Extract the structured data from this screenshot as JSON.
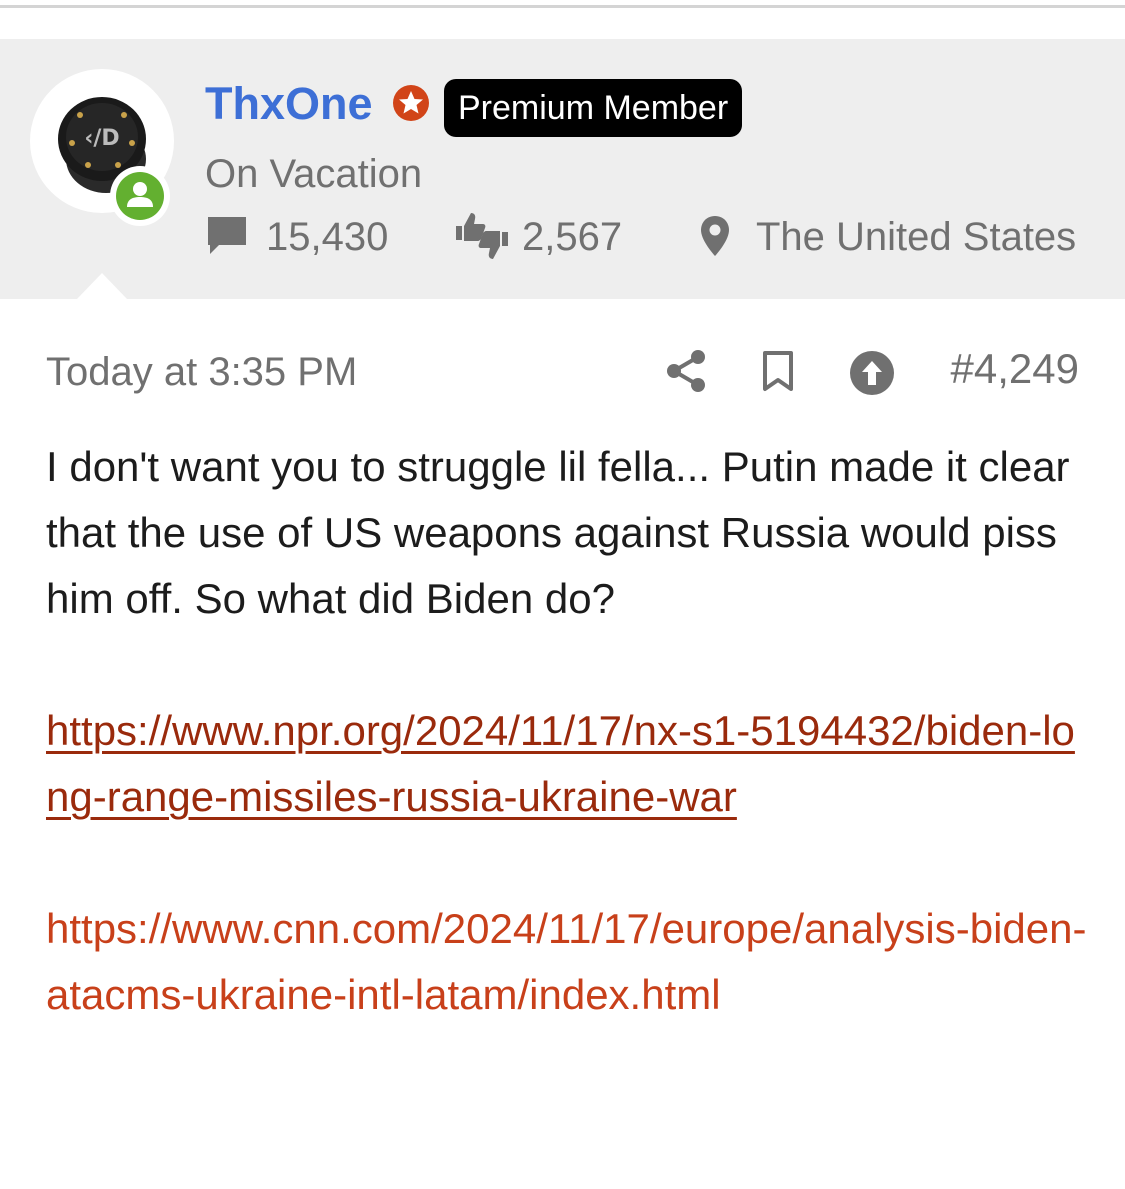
{
  "user": {
    "name": "ThxOne",
    "badge": "Premium Member",
    "status": "On Vacation",
    "messages": "15,430",
    "reactions": "2,567",
    "location": "The United States"
  },
  "post": {
    "time": "Today at 3:35 PM",
    "number": "#4,249",
    "text": "I don't want you to struggle lil fella... Putin made it clear that the use of US weapons against Russia would piss him off. So what did Biden do?",
    "links": [
      "https://www.npr.org/2024/11/17/nx-s1-5194432/biden-long-range-missiles-russia-ukraine-war",
      "https://www.cnn.com/2024/11/17/europe/analysis-biden-atacms-ukraine-intl-latam/index.html"
    ]
  },
  "colors": {
    "username": "#3d6fd6",
    "online": "#63b030",
    "star_badge": "#d14418",
    "link_visited": "#9a2a0c",
    "link": "#c8401a",
    "panel_bg": "#eeeeee"
  }
}
